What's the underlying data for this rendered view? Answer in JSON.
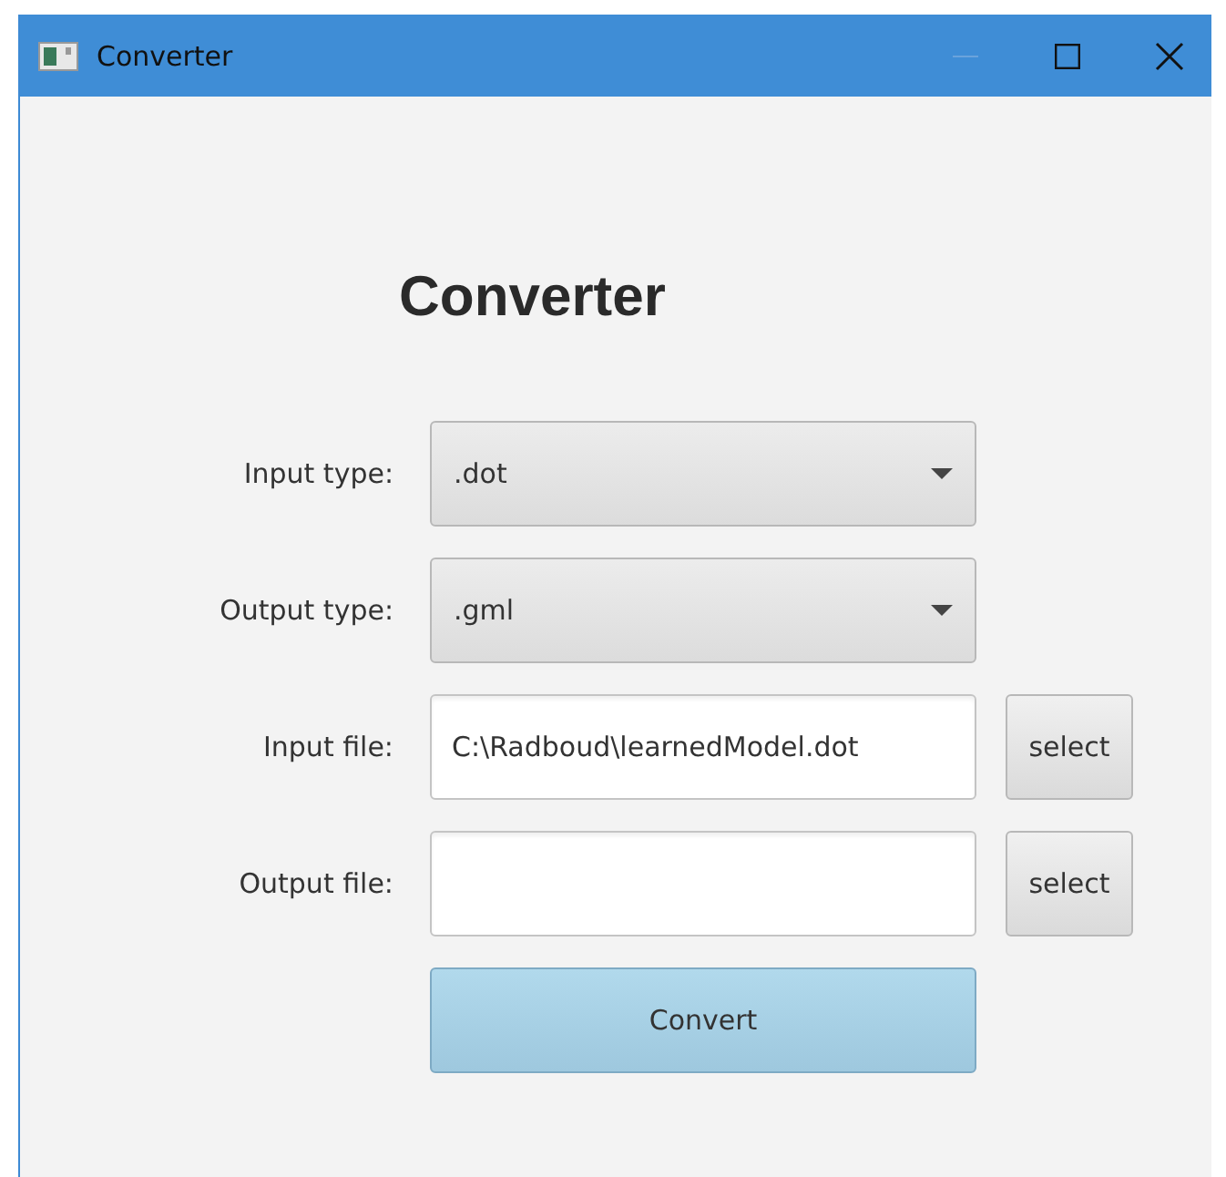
{
  "window": {
    "title": "Converter"
  },
  "heading": "Converter",
  "rows": [
    {
      "label": "Input type:",
      "kind": "combo",
      "value": ".dot"
    },
    {
      "label": "Output type:",
      "kind": "combo",
      "value": ".gml"
    },
    {
      "label": "Input file:",
      "kind": "file",
      "value": "C:\\Radboud\\learnedModel.dot",
      "button": "select"
    },
    {
      "label": "Output file:",
      "kind": "file",
      "button": "select"
    }
  ],
  "convert_button": "Convert"
}
